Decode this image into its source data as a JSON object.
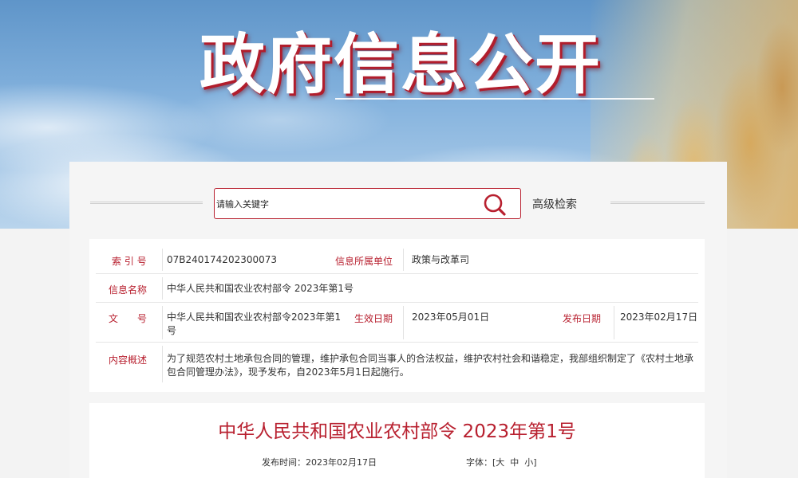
{
  "banner": {
    "title": "政府信息公开"
  },
  "search": {
    "placeholder": "请输入关键字",
    "advanced_label": "高级检索"
  },
  "info": {
    "index_label": "索 引 号",
    "index_value": "07B240174202300073",
    "unit_label": "信息所属单位",
    "unit_value": "政策与改革司",
    "name_label": "信息名称",
    "name_value": "中华人民共和国农业农村部令 2023年第1号",
    "doc_label": "文　　号",
    "doc_value": "中华人民共和国农业农村部令2023年第1号",
    "effective_label": "生效日期",
    "effective_value": "2023年05月01日",
    "publish_label": "发布日期",
    "publish_value": "2023年02月17日",
    "summary_label": "内容概述",
    "summary_value": "为了规范农村土地承包合同的管理，维护承包合同当事人的合法权益，维护农村社会和谐稳定，我部组织制定了《农村土地承包合同管理办法》，现予发布，自2023年5月1日起施行。"
  },
  "article": {
    "title": "中华人民共和国农业农村部令 2023年第1号",
    "publish_time_label": "发布时间：",
    "publish_time": "2023年02月17日",
    "font_size_label": "字体：",
    "font_sizes": {
      "open": "[",
      "large": "大",
      "medium": "中",
      "small": "小",
      "close": "]"
    }
  },
  "colors": {
    "accent": "#b8202f",
    "page_bg": "#f5f5f5",
    "card_bg": "#ffffff"
  }
}
